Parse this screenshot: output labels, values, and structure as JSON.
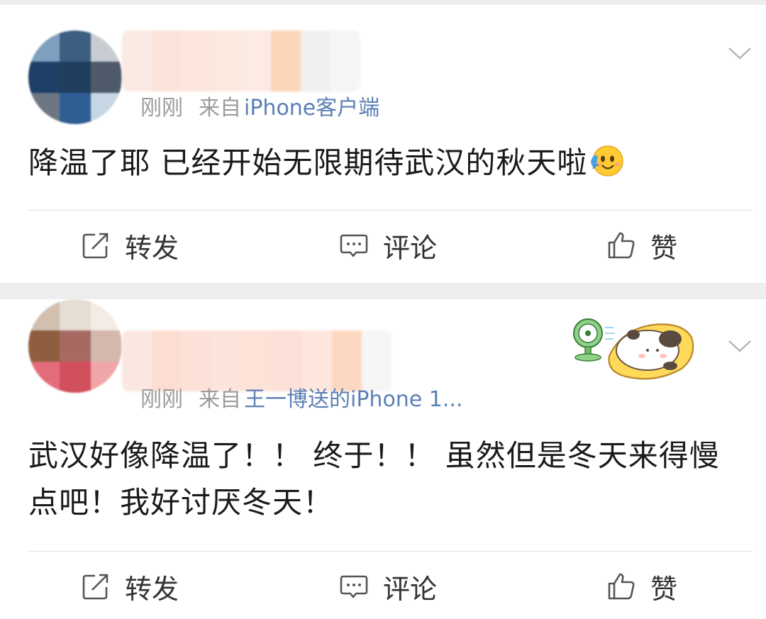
{
  "posts": [
    {
      "time": "刚刚",
      "source_prefix": "来自",
      "source": "iPhone客户端",
      "text": "降温了耶 已经开始无限期待武汉的秋天啦",
      "emoji": "hug-emoji",
      "actions": {
        "repost": "转发",
        "comment": "评论",
        "like": "赞"
      }
    },
    {
      "time": "刚刚",
      "source_prefix": "来自",
      "source": "王一博送的iPhone 1...",
      "text": "武汉好像降温了！！ 终于！！ 虽然但是冬天来得慢点吧！我好讨厌冬天！",
      "sticker": "panda-with-fan-sticker",
      "actions": {
        "repost": "转发",
        "comment": "评论",
        "like": "赞"
      }
    }
  ],
  "colors": {
    "link": "#5b7fb5",
    "meta": "#9b9b9b",
    "text": "#1a1a1a",
    "separator": "#eeeeee"
  }
}
